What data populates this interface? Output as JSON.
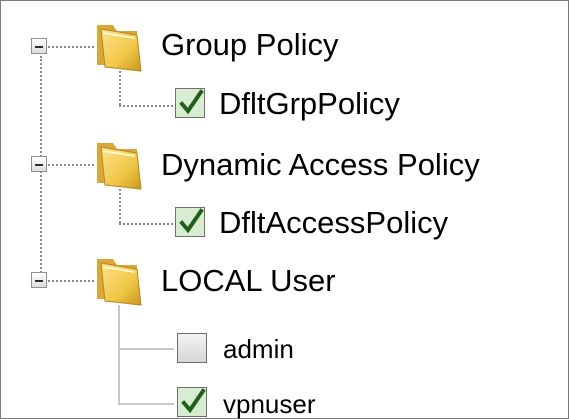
{
  "tree": {
    "nodes": [
      {
        "label": "Group Policy",
        "expanded": true,
        "icon": "folder-icon",
        "children": [
          {
            "label": "DfltGrpPolicy",
            "checked": true
          }
        ]
      },
      {
        "label": "Dynamic Access Policy",
        "expanded": true,
        "icon": "folder-icon",
        "children": [
          {
            "label": "DfltAccessPolicy",
            "checked": true
          }
        ]
      },
      {
        "label": "LOCAL User",
        "expanded": true,
        "icon": "folder-icon",
        "children": [
          {
            "label": "admin",
            "checked": false
          },
          {
            "label": "vpnuser",
            "checked": true
          }
        ]
      }
    ]
  },
  "colors": {
    "check": "#1f5f1a",
    "checkbox_checked_bg": "#d8ecd2",
    "folder": "#f1c748"
  }
}
